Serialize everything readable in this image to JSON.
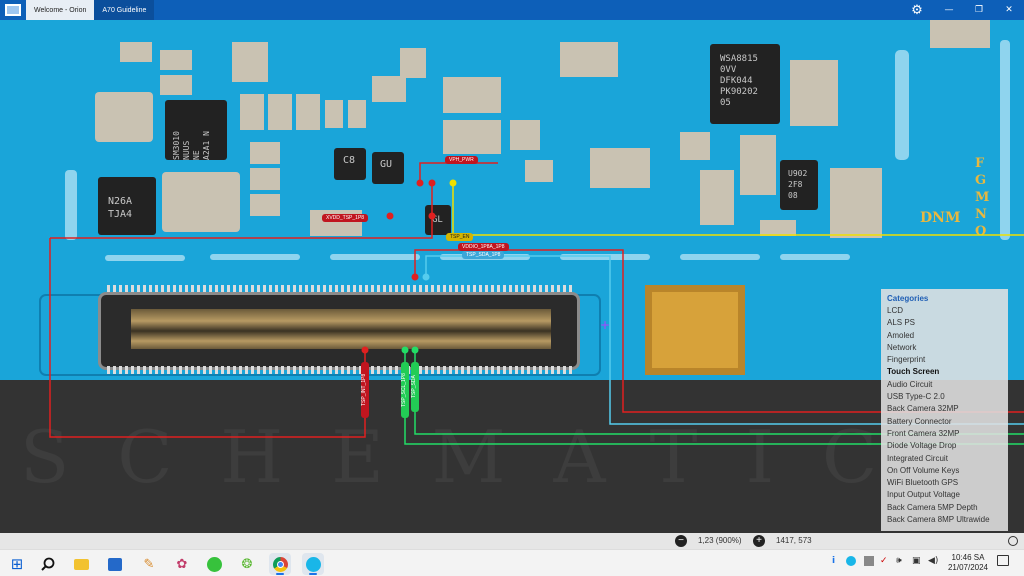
{
  "window": {
    "tabs": [
      {
        "label": "Welcome - Orion"
      },
      {
        "label": "A70 Guideline"
      }
    ],
    "controls": {
      "minimize": "—",
      "restore": "❐",
      "close": "✕"
    }
  },
  "board": {
    "chips": [
      {
        "text": "SM3010\nNUUS\nNE\nA2A1 N"
      },
      {
        "text": "WSA8815\n0VV\nDFK044\nPK90202\n05"
      },
      {
        "text": "N26A\nTJA4"
      },
      {
        "text": "U902\n2F8\n08"
      },
      {
        "text": "C8"
      },
      {
        "text": "GU"
      },
      {
        "text": "GL"
      }
    ],
    "silkscreen": {
      "dnm": "DNM",
      "vertical": "FGMNO"
    },
    "watermark": "SCHEMATIC"
  },
  "probes": {
    "labels": [
      {
        "text": "VPH_PWR",
        "color": "#c0151f"
      },
      {
        "text": "XVDD_TSP_1P8",
        "color": "#c0151f"
      },
      {
        "text": "TSP_EN",
        "color": "#d4b400"
      },
      {
        "text": "VDDIO_1P8A_1P8",
        "color": "#c0151f"
      },
      {
        "text": "TSP_SDA_1P8",
        "color": "#3ba7d8"
      }
    ],
    "vertical": [
      {
        "text": "TSP_INT_1P8",
        "color": "#c0151f"
      },
      {
        "text": "TSP_SCL_1P8",
        "color": "#22cc55"
      },
      {
        "text": "TSP_SDA",
        "color": "#22cc55"
      }
    ]
  },
  "categories": {
    "title": "Categories",
    "active": "Touch Screen",
    "items": [
      "LCD",
      "ALS PS",
      "Amoled",
      "Network",
      "Fingerprint",
      "Touch Screen",
      "Audio Circuit",
      "USB Type-C 2.0",
      "Back Camera 32MP",
      "Battery Connector",
      "Front Camera 32MP",
      "Diode Voltage Drop",
      "Integrated Circuit",
      "On Off Volume Keys",
      "WiFi Bluetooth GPS",
      "Input Output Voltage",
      "Back Camera 5MP Depth",
      "Back Camera 8MP Ultrawide"
    ]
  },
  "status": {
    "zoom_out": "−",
    "zoom_level": "1,23 (900%)",
    "zoom_in": "+",
    "cursor": "1417, 573"
  },
  "taskbar": {
    "apps": [
      {
        "icon": "windows-start-icon"
      },
      {
        "icon": "search-icon"
      },
      {
        "icon": "file-explorer-icon"
      },
      {
        "icon": "store-icon"
      },
      {
        "icon": "paint-icon"
      },
      {
        "icon": "network-app-icon"
      },
      {
        "icon": "owl-app-icon"
      },
      {
        "icon": "green-app-icon"
      },
      {
        "icon": "chrome-icon"
      },
      {
        "icon": "orion-app-icon"
      }
    ],
    "time": "10:46 SA",
    "date": "21/07/2024"
  },
  "colors": {
    "red": "#c0151f",
    "yellow": "#f0e000",
    "cyan": "#55ccee",
    "green": "#22dd66",
    "board": "#1aa5d9"
  }
}
